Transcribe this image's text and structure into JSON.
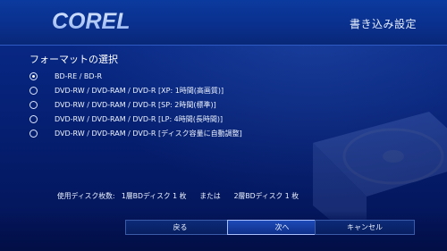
{
  "header": {
    "logo_text": "COREL",
    "title": "書き込み設定"
  },
  "format": {
    "section_title": "フォーマットの選択",
    "options": [
      {
        "label": "BD-RE / BD-R",
        "checked": true
      },
      {
        "label": "DVD-RW / DVD-RAM / DVD-R [XP: 1時間(高画質)]",
        "checked": false
      },
      {
        "label": "DVD-RW / DVD-RAM / DVD-R [SP: 2時間(標準)]",
        "checked": false
      },
      {
        "label": "DVD-RW / DVD-RAM / DVD-R [LP: 4時間(長時間)]",
        "checked": false
      },
      {
        "label": "DVD-RW / DVD-RAM / DVD-R [ディスク容量に自動調整]",
        "checked": false
      }
    ]
  },
  "usage": {
    "label": "使用ディスク枚数:",
    "value1": "1層BDディスク 1 枚",
    "separator": "または",
    "value2": "2層BDディスク 1 枚"
  },
  "buttons": {
    "back": "戻る",
    "next": "次へ",
    "cancel": "キャンセル"
  },
  "colors": {
    "background": "#041a66",
    "header": "#0a2f8c",
    "accent": "#a8c0ff"
  }
}
